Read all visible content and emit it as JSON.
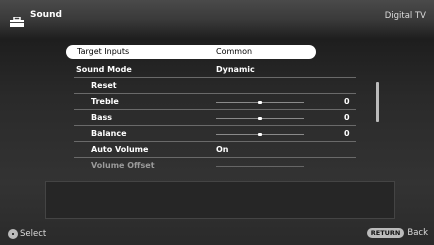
{
  "header": {
    "title": "Sound",
    "source": "Digital TV",
    "icon": "toolbox-icon"
  },
  "menu": {
    "items": [
      {
        "label": "Target Inputs",
        "value": "Common",
        "selected": true
      },
      {
        "label": "Sound Mode",
        "value": "Dynamic"
      },
      {
        "label": "Reset",
        "value": ""
      },
      {
        "label": "Treble",
        "value": "0",
        "slider": 0.5
      },
      {
        "label": "Bass",
        "value": "0",
        "slider": 0.5
      },
      {
        "label": "Balance",
        "value": "0",
        "slider": 0.5
      },
      {
        "label": "Auto Volume",
        "value": "On"
      },
      {
        "label": "Volume Offset",
        "value": "",
        "slider": 0.5,
        "disabled": true
      }
    ]
  },
  "footer": {
    "select_label": "Select",
    "return_key": "RETURN",
    "back_label": "Back"
  }
}
